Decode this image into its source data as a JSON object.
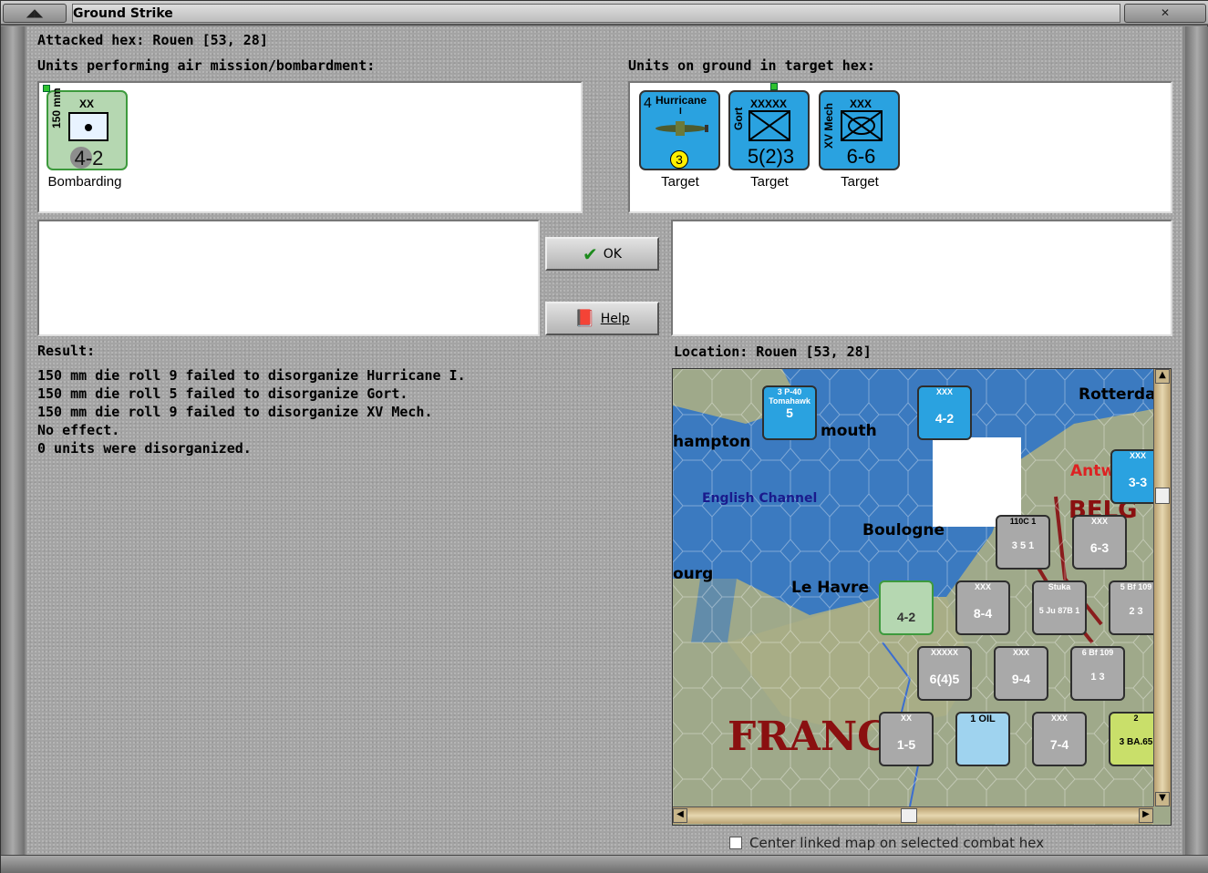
{
  "window": {
    "title": "Ground Strike"
  },
  "attacked_hex": "Attacked hex: Rouen  [53, 28]",
  "air_units": {
    "header": "Units performing air mission/bombardment:",
    "units": [
      {
        "side_label": "150 mm",
        "size": "XX",
        "strength": "4-2",
        "status": "Bombarding",
        "color": "#b5d7b1"
      }
    ]
  },
  "ground_units": {
    "header": "Units on ground in target hex:",
    "units": [
      {
        "name": "Hurricane",
        "variant": "I",
        "range": "4",
        "bottom": "3",
        "status": "Target",
        "color": "#2aa2e0"
      },
      {
        "side_label": "Gort",
        "size": "XXXXX",
        "strength": "5(2)3",
        "status": "Target",
        "color": "#2aa2e0"
      },
      {
        "side_label": "XV Mech",
        "size": "XXX",
        "strength": "6-6",
        "status": "Target",
        "color": "#2aa2e0"
      }
    ]
  },
  "buttons": {
    "ok": "OK",
    "help": "Help"
  },
  "result": {
    "label": "Result:",
    "lines": [
      "150 mm die roll 9 failed to disorganize Hurricane I.",
      "150 mm die roll 5 failed to disorganize Gort.",
      "150 mm die roll 9 failed to disorganize XV Mech.",
      "No effect.",
      "0 units were disorganized."
    ]
  },
  "location": "Location:  Rouen  [53, 28]",
  "map": {
    "places": [
      "hampton",
      "mouth",
      "Rotterda",
      "English Channel",
      "Antw",
      "Boulogne",
      "ourg",
      "Le Havre",
      "FRANC",
      "BELG"
    ],
    "counters": [
      {
        "top": "3   P-40",
        "sub": "Tomahawk",
        "val": "5",
        "color": "#2aa2e0"
      },
      {
        "top": "XXX",
        "val": "4-2",
        "color": "#2aa2e0"
      },
      {
        "top": "XXX",
        "val": "3-3",
        "color": "#2aa2e0"
      },
      {
        "top": "110C 1",
        "val": "3  5  1",
        "color": "#a9a9a9"
      },
      {
        "top": "XXX",
        "val": "6-3",
        "color": "#a9a9a9"
      },
      {
        "top": "4-2",
        "val": "4-2",
        "color": "#a9a9a9"
      },
      {
        "top": "XXX",
        "val": "8-4",
        "color": "#a9a9a9"
      },
      {
        "top": "Stuka",
        "val": "5  Ju 87B  1",
        "color": "#a9a9a9"
      },
      {
        "top": "5 Bf 109",
        "val": "2   3",
        "color": "#a9a9a9"
      },
      {
        "top": "XXXXX",
        "val": "6(4)5",
        "color": "#a9a9a9"
      },
      {
        "top": "XXX",
        "val": "9-4",
        "color": "#a9a9a9"
      },
      {
        "top": "6 Bf 109",
        "val": "1   3",
        "color": "#a9a9a9"
      },
      {
        "top": "XX",
        "val": "1-5",
        "color": "#a9a9a9"
      },
      {
        "top": "1 OIL",
        "val": "",
        "color": "#9fd3ef"
      },
      {
        "top": "XXX",
        "val": "7-4",
        "color": "#a9a9a9"
      },
      {
        "top": "2",
        "val": "3  BA.65",
        "color": "#a9a9a9"
      }
    ]
  },
  "center_linked": "Center linked map on selected combat hex"
}
